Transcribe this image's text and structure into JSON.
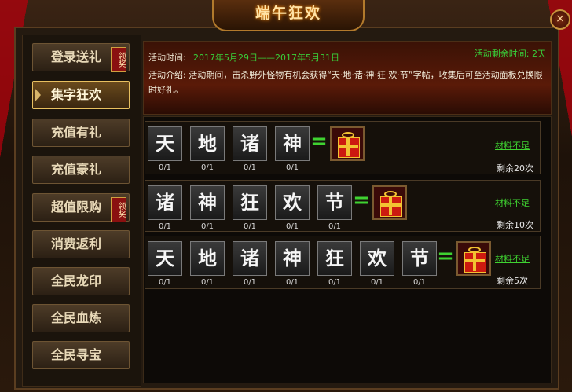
{
  "title": "端午狂欢",
  "close_symbol": "×",
  "sidebar": {
    "items": [
      {
        "label": "登录送礼",
        "badge": "领奖"
      },
      {
        "label": "集字狂欢",
        "active": true
      },
      {
        "label": "充值有礼"
      },
      {
        "label": "充值豪礼"
      },
      {
        "label": "超值限购",
        "badge": "领奖"
      },
      {
        "label": "消费返利"
      },
      {
        "label": "全民龙印"
      },
      {
        "label": "全民血炼"
      },
      {
        "label": "全民寻宝"
      }
    ]
  },
  "info": {
    "time_label": "活动时间:",
    "time_value": "2017年5月29日——2017年5月31日",
    "remaining": "活动剩余时间: 2天",
    "description": "活动介绍: 活动期间，击杀野外怪物有机会获得“天·地·诸·神·狂·欢·节”字帖，收集后可至活动面板兑换限时好礼。"
  },
  "rows": [
    {
      "chars": [
        "天",
        "地",
        "诸",
        "神"
      ],
      "counts": [
        "0/1",
        "0/1",
        "0/1",
        "0/1"
      ],
      "material": "材料不足",
      "remain": "剩余20次"
    },
    {
      "chars": [
        "诸",
        "神",
        "狂",
        "欢",
        "节"
      ],
      "counts": [
        "0/1",
        "0/1",
        "0/1",
        "0/1",
        "0/1"
      ],
      "material": "材料不足",
      "remain": "剩余10次"
    },
    {
      "chars": [
        "天",
        "地",
        "诸",
        "神",
        "狂",
        "欢",
        "节"
      ],
      "counts": [
        "0/1",
        "0/1",
        "0/1",
        "0/1",
        "0/1",
        "0/1",
        "0/1"
      ],
      "material": "材料不足",
      "remain": "剩余5次"
    }
  ],
  "colors": {
    "accent_green": "#3fd231",
    "gold": "#e8c060",
    "ribbon_red": "#b3000c"
  }
}
